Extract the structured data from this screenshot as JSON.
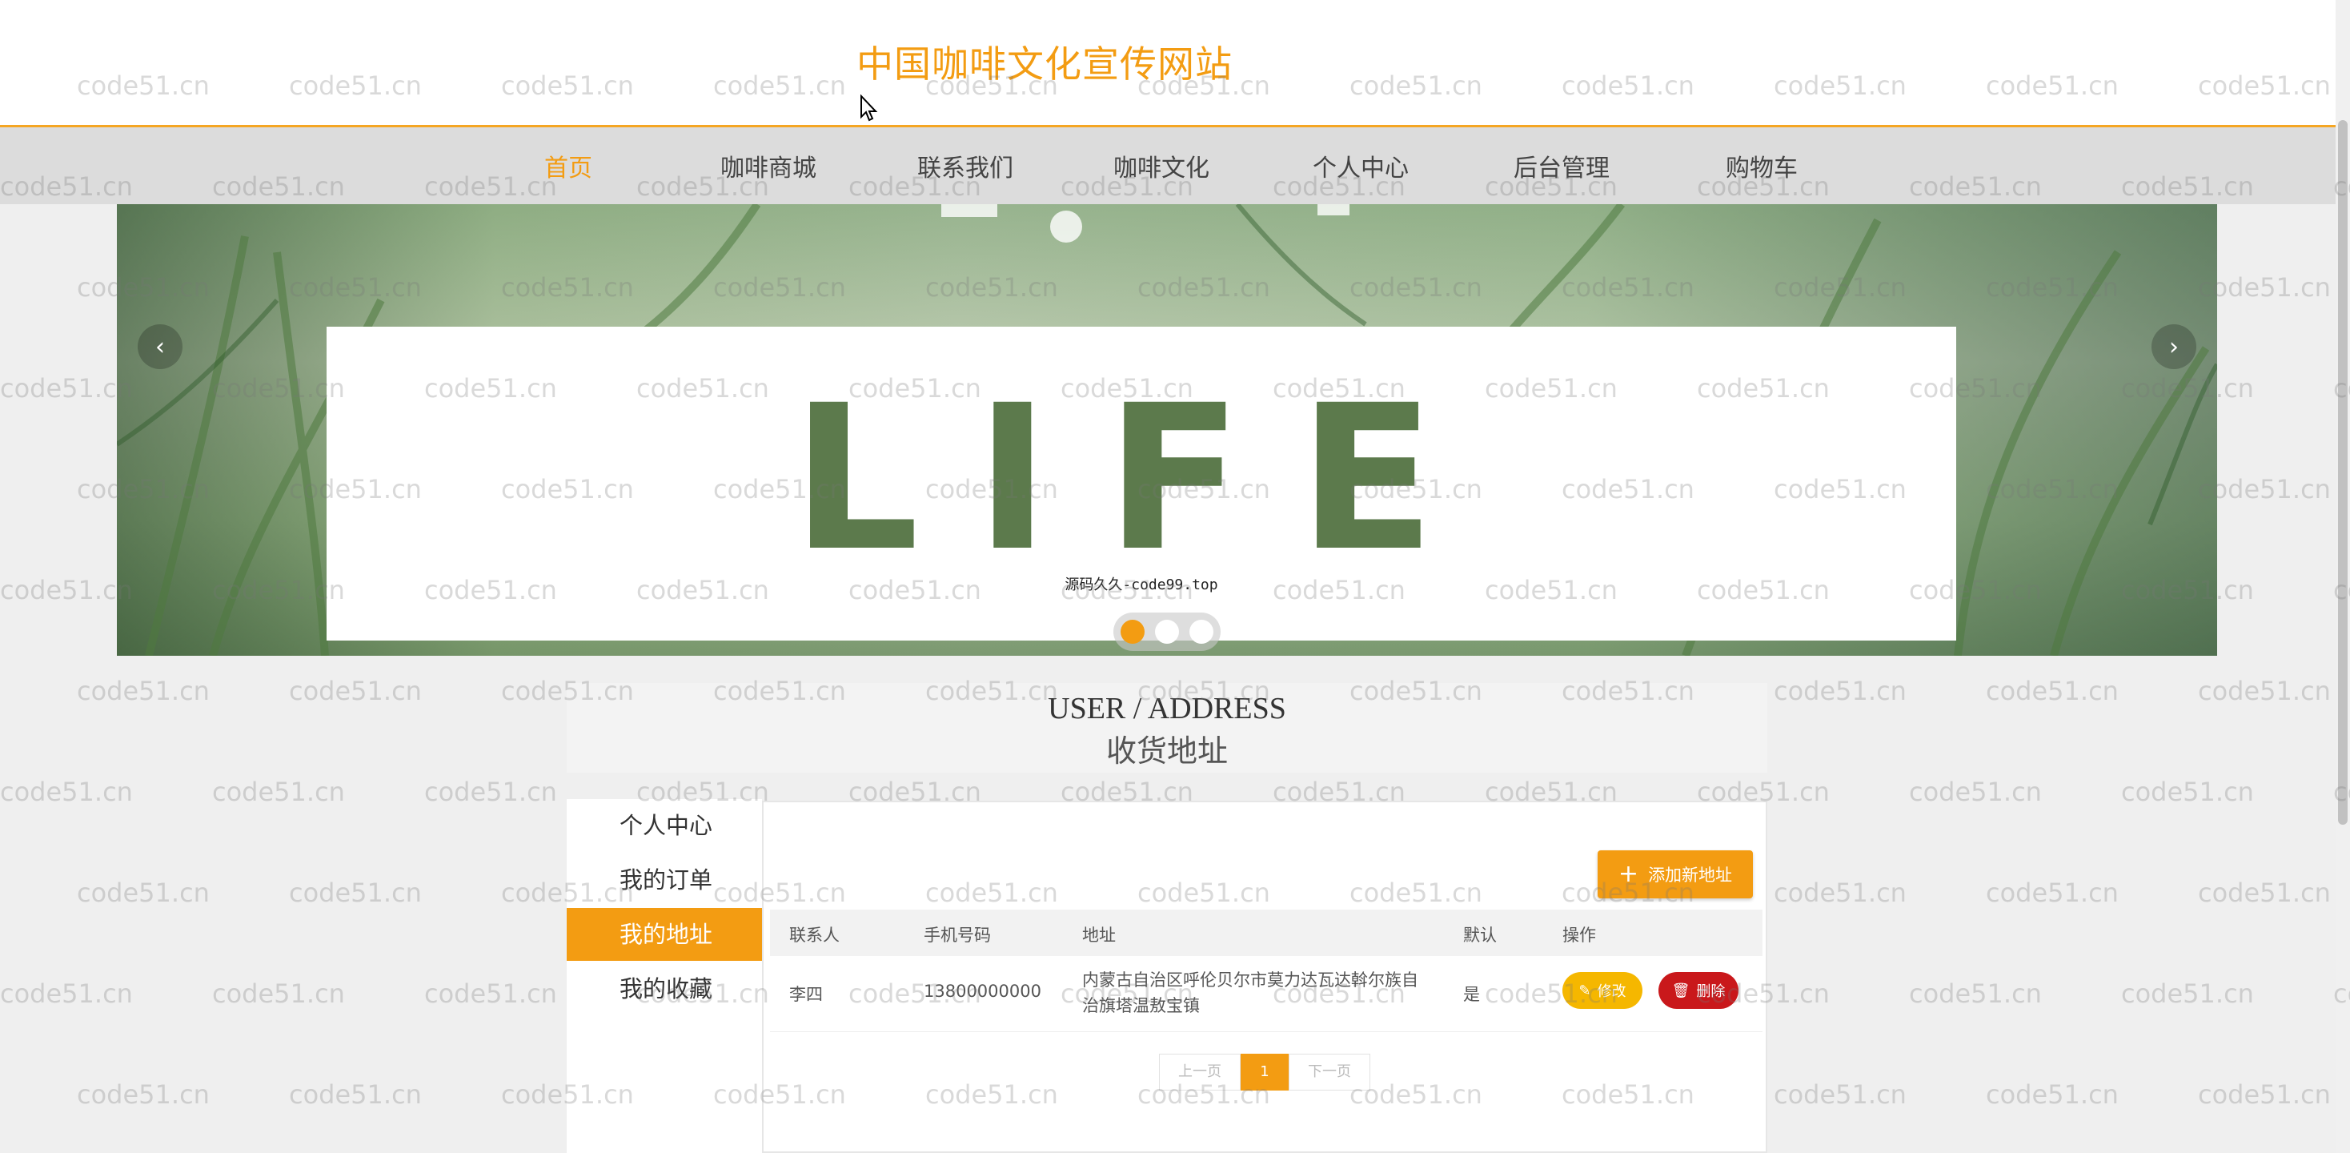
{
  "header": {
    "site_title": "中国咖啡文化宣传网站"
  },
  "nav": {
    "items": [
      {
        "label": "首页",
        "active": true
      },
      {
        "label": "咖啡商城",
        "active": false
      },
      {
        "label": "联系我们",
        "active": false
      },
      {
        "label": "咖啡文化",
        "active": false
      },
      {
        "label": "个人中心",
        "active": false
      },
      {
        "label": "后台管理",
        "active": false
      },
      {
        "label": "购物车",
        "active": false
      }
    ]
  },
  "banner": {
    "big_text": "LIFE",
    "caption": "源码久久-code99.top",
    "prev_icon": "chevron-left-icon",
    "next_icon": "chevron-right-icon",
    "slides": 3,
    "active_slide": 1
  },
  "section": {
    "title_en": "USER / ADDRESS",
    "title_zh": "收货地址"
  },
  "side_menu": {
    "items": [
      {
        "label": "个人中心",
        "active": false
      },
      {
        "label": "我的订单",
        "active": false
      },
      {
        "label": "我的地址",
        "active": true
      },
      {
        "label": "我的收藏",
        "active": false
      }
    ]
  },
  "address": {
    "add_button": "添加新地址",
    "columns": [
      "联系人",
      "手机号码",
      "地址",
      "默认",
      "操作"
    ],
    "rows": [
      {
        "contact": "李四",
        "phone": "13800000000",
        "address_line1": "内蒙古自治区呼伦贝尔市莫力达瓦达斡尔族自",
        "address_line2": "治旗塔温敖宝镇",
        "default": "是",
        "edit_label": "修改",
        "delete_label": "删除"
      }
    ],
    "pager": {
      "prev": "上一页",
      "current": "1",
      "next": "下一页"
    }
  },
  "watermark": "code51.cn",
  "colors": {
    "accent": "#f39c12",
    "delete": "#c9181b",
    "edit": "#f5b700"
  }
}
